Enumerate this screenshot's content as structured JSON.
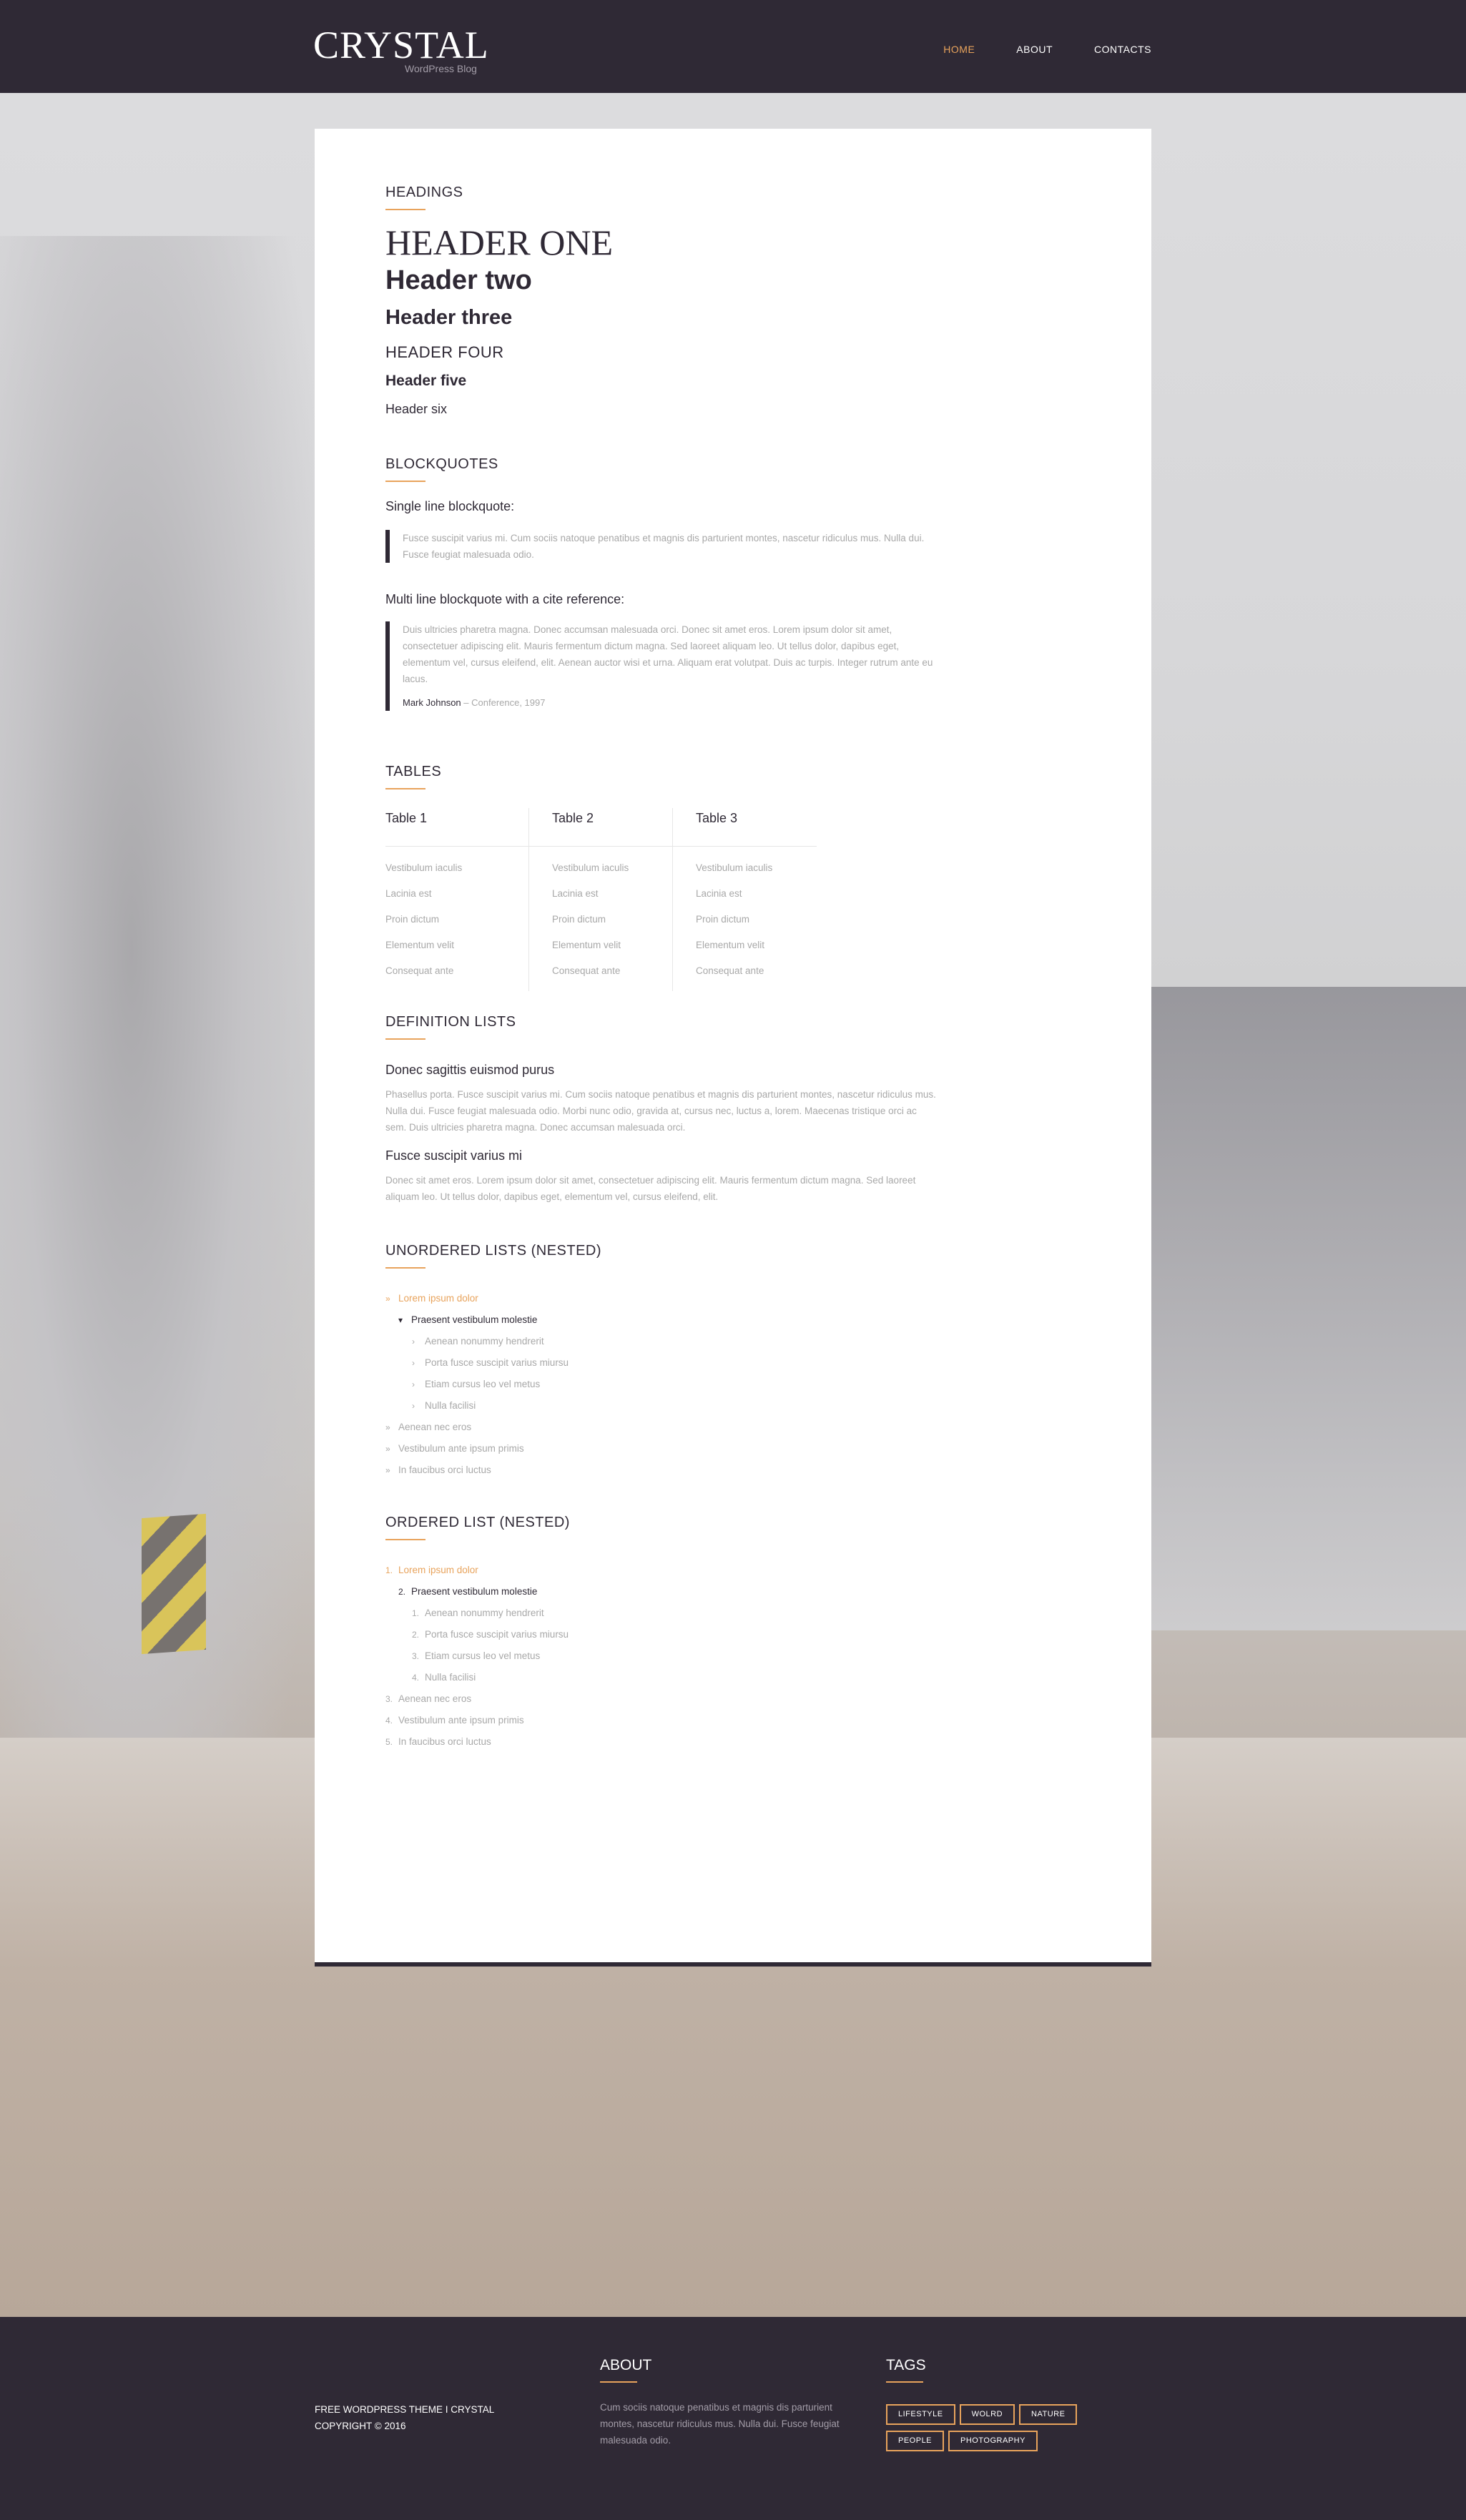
{
  "header": {
    "logo": "CRYSTAL",
    "tagline": "WordPress Blog",
    "nav": [
      {
        "label": "HOME",
        "active": true
      },
      {
        "label": "ABOUT",
        "active": false
      },
      {
        "label": "CONTACTS",
        "active": false
      }
    ]
  },
  "headings": {
    "title": "HEADINGS",
    "h1": "HEADER ONE",
    "h2": "Header two",
    "h3": "Header three",
    "h4": "HEADER FOUR",
    "h5": "Header five",
    "h6": "Header six"
  },
  "blockquotes": {
    "title": "BLOCKQUOTES",
    "single_label": "Single line blockquote:",
    "single_text": "Fusce suscipit varius mi. Cum sociis natoque penatibus et magnis dis parturient montes, nascetur ridiculus mus. Nulla dui. Fusce feugiat malesuada odio.",
    "multi_label": "Multi line blockquote with a cite reference:",
    "multi_text": "Duis ultricies pharetra magna. Donec accumsan malesuada orci. Donec sit amet eros. Lorem ipsum dolor sit amet, consectetuer adipiscing elit. Mauris fermentum dictum magna. Sed laoreet aliquam leo. Ut tellus dolor, dapibus eget, elementum vel, cursus eleifend, elit. Aenean auctor wisi et urna. Aliquam erat volutpat. Duis ac turpis. Integer rutrum ante eu lacus.",
    "cite_name": "Mark Johnson",
    "cite_source": "– Conference, 1997"
  },
  "tables": {
    "title": "TABLES",
    "columns": [
      {
        "header": "Table 1",
        "rows": [
          "Vestibulum iaculis",
          "Lacinia est",
          "Proin dictum",
          "Elementum velit",
          "Consequat ante"
        ]
      },
      {
        "header": "Table 2",
        "rows": [
          "Vestibulum iaculis",
          "Lacinia est",
          "Proin dictum",
          "Elementum velit",
          "Consequat ante"
        ]
      },
      {
        "header": "Table 3",
        "rows": [
          "Vestibulum iaculis",
          "Lacinia est",
          "Proin dictum",
          "Elementum velit",
          "Consequat ante"
        ]
      }
    ]
  },
  "definitions": {
    "title": "DEFINITION LISTS",
    "items": [
      {
        "term": "Donec sagittis euismod purus",
        "desc": "Phasellus porta. Fusce suscipit varius mi. Cum sociis natoque penatibus et magnis dis parturient montes, nascetur ridiculus mus. Nulla dui. Fusce feugiat malesuada odio. Morbi nunc odio, gravida at, cursus nec, luctus a, lorem. Maecenas tristique orci ac sem. Duis ultricies pharetra magna. Donec accumsan malesuada orci."
      },
      {
        "term": "Fusce suscipit varius mi",
        "desc": "Donec sit amet eros. Lorem ipsum dolor sit amet, consectetuer adipiscing elit. Mauris fermentum dictum magna. Sed laoreet aliquam leo. Ut tellus dolor, dapibus eget, elementum vel, cursus eleifend, elit."
      }
    ]
  },
  "unordered": {
    "title": "UNORDERED LISTS (NESTED)",
    "items": [
      {
        "label": "Lorem ipsum dolor",
        "marker": "»",
        "level": 0,
        "style": "accent"
      },
      {
        "label": "Praesent vestibulum molestie",
        "marker": "▾",
        "level": 1,
        "style": "dark"
      },
      {
        "label": "Aenean nonummy hendrerit",
        "marker": "›",
        "level": 2,
        "style": ""
      },
      {
        "label": "Porta fusce suscipit varius miursu",
        "marker": "›",
        "level": 2,
        "style": ""
      },
      {
        "label": "Etiam cursus leo vel metus",
        "marker": "›",
        "level": 2,
        "style": ""
      },
      {
        "label": "Nulla facilisi",
        "marker": "›",
        "level": 2,
        "style": ""
      },
      {
        "label": "Aenean nec eros",
        "marker": "»",
        "level": 0,
        "style": ""
      },
      {
        "label": "Vestibulum ante ipsum primis",
        "marker": "»",
        "level": 0,
        "style": ""
      },
      {
        "label": "In faucibus orci luctus",
        "marker": "»",
        "level": 0,
        "style": ""
      }
    ]
  },
  "ordered": {
    "title": "ORDERED LIST (NESTED)",
    "items": [
      {
        "label": "Lorem ipsum dolor",
        "marker": "1.",
        "level": 0,
        "style": "accent"
      },
      {
        "label": "Praesent vestibulum molestie",
        "marker": "2.",
        "level": 1,
        "style": "dark"
      },
      {
        "label": "Aenean nonummy hendrerit",
        "marker": "1.",
        "level": 2,
        "style": ""
      },
      {
        "label": "Porta fusce suscipit varius miursu",
        "marker": "2.",
        "level": 2,
        "style": ""
      },
      {
        "label": "Etiam cursus leo vel metus",
        "marker": "3.",
        "level": 2,
        "style": ""
      },
      {
        "label": "Nulla facilisi",
        "marker": "4.",
        "level": 2,
        "style": ""
      },
      {
        "label": "Aenean nec eros",
        "marker": "3.",
        "level": 0,
        "style": ""
      },
      {
        "label": "Vestibulum ante ipsum primis",
        "marker": "4.",
        "level": 0,
        "style": ""
      },
      {
        "label": "In faucibus orci luctus",
        "marker": "5.",
        "level": 0,
        "style": ""
      }
    ]
  },
  "footer": {
    "copy_line1": "FREE WORDPRESS THEME I CRYSTAL",
    "copy_line2": "COPYRIGHT © 2016",
    "about_title": "ABOUT",
    "about_text": "Cum sociis natoque penatibus et magnis dis parturient montes, nascetur ridiculus mus. Nulla dui. Fusce feugiat malesuada odio.",
    "tags_title": "TAGS",
    "tags": [
      "LIFESTYLE",
      "WOLRD",
      "NATURE",
      "PEOPLE",
      "PHOTOGRAPHY"
    ]
  },
  "colors": {
    "dark": "#2f2935",
    "accent": "#e8a35c",
    "muted": "#a8a8a8"
  }
}
